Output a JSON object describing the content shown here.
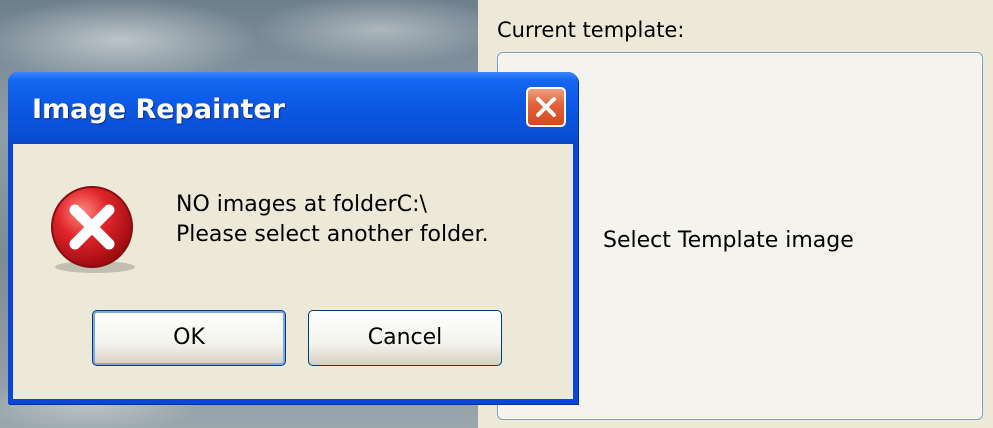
{
  "background": {
    "section_label": "Current template:",
    "template_placeholder": "Select Template image"
  },
  "dialog": {
    "title": "Image Repainter",
    "message_line1": "NO images at folderC:\\",
    "message_line2": "Please select another folder.",
    "ok_label": "OK",
    "cancel_label": "Cancel",
    "icons": {
      "close": "close-icon",
      "error": "error-icon"
    }
  },
  "colors": {
    "titlebar": "#0a4fd6",
    "dialog_body": "#ece9d8",
    "close_button": "#d24a22",
    "error_icon": "#c8161d"
  }
}
